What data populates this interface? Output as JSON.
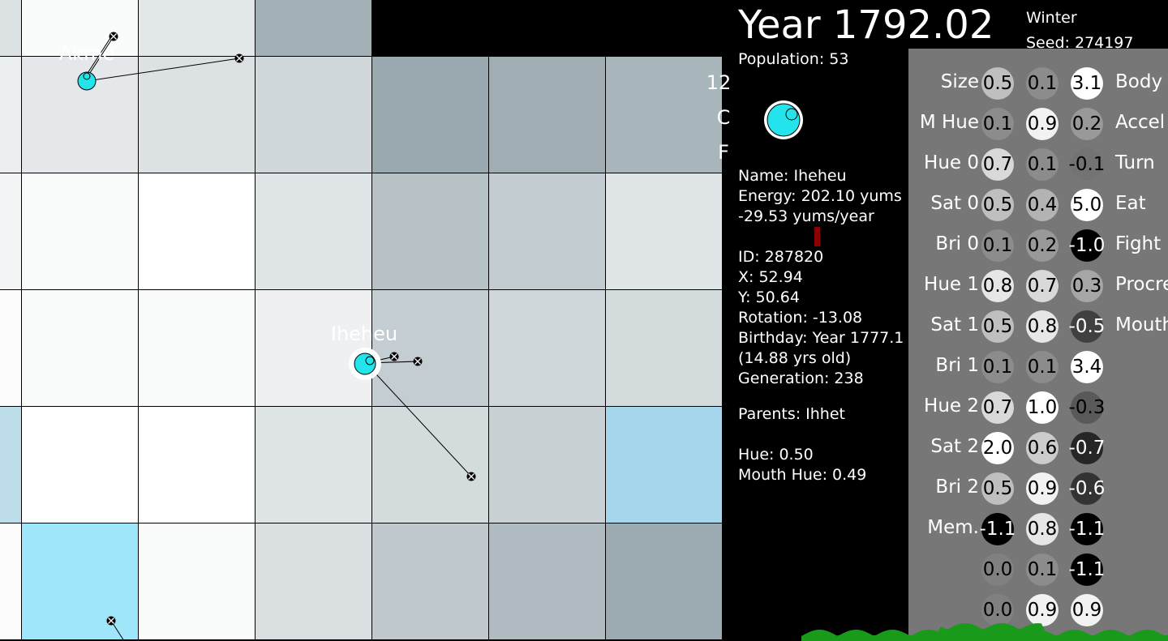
{
  "header": {
    "year": "Year 1792.02",
    "season": "Winter",
    "seed": "Seed: 274197",
    "population": "Population: 53"
  },
  "selected": {
    "name": "Name: Iheheu",
    "energy": "Energy: 202.10 yums",
    "energy_rate": "-29.53 yums/year",
    "id": "ID: 287820",
    "x": "X: 52.94",
    "y": "Y: 50.64",
    "rotation": "Rotation: -13.08",
    "birthday": "Birthday: Year 1777.1",
    "age": "(14.88 yrs old)",
    "generation": "Generation: 238",
    "parents": "Parents: Ihhet",
    "hue": "Hue: 0.50",
    "mouth_hue": "Mouth Hue: 0.49",
    "body_color": "#22e4ea"
  },
  "world": {
    "grid_values": [
      [
        0.78,
        0.97,
        0.82,
        0.42,
        null,
        null,
        null
      ],
      [
        0.88,
        0.83,
        0.78,
        0.71,
        0.36,
        0.4,
        0.45
      ],
      [
        0.92,
        0.96,
        1.0,
        0.8,
        0.55,
        0.62,
        0.8
      ],
      [
        0.98,
        0.96,
        0.96,
        0.89,
        0.63,
        0.7,
        0.73
      ],
      [
        0.69,
        1.0,
        1.0,
        0.79,
        0.73,
        0.66,
        0.45
      ],
      [
        0.98,
        0.62,
        0.97,
        0.76,
        0.6,
        0.5,
        0.38
      ]
    ],
    "labels": {
      "akme": "Akme",
      "iheheu": "Iheheu"
    },
    "side_text": [
      "12",
      "C",
      "F"
    ],
    "creature_color": "#22e4ea"
  },
  "brain": {
    "input_labels": [
      "Size",
      "M Hue",
      "Hue 0",
      "Sat 0",
      "Bri 0",
      "Hue 1",
      "Sat 1",
      "Bri 1",
      "Hue 2",
      "Sat 2",
      "Bri 2",
      "Mem.",
      "",
      ""
    ],
    "output_labels": [
      "Body",
      "Accel",
      "Turn",
      "Eat",
      "Fight",
      "Procre",
      "Mouth",
      "",
      "",
      "",
      "",
      "",
      "",
      ""
    ],
    "col1": [
      0.5,
      0.1,
      0.7,
      0.5,
      0.1,
      0.8,
      0.5,
      0.1,
      0.7,
      2.0,
      0.5,
      -1.1,
      0.0,
      0.0
    ],
    "col2": [
      0.1,
      0.9,
      0.1,
      0.4,
      0.2,
      0.7,
      0.8,
      0.1,
      1.0,
      0.6,
      0.9,
      0.8,
      0.1,
      0.9
    ],
    "col3": [
      3.1,
      0.2,
      -0.1,
      5.0,
      -1.0,
      0.3,
      -0.5,
      3.4,
      -0.3,
      -0.7,
      -0.6,
      -1.1,
      -1.1,
      0.9
    ]
  }
}
